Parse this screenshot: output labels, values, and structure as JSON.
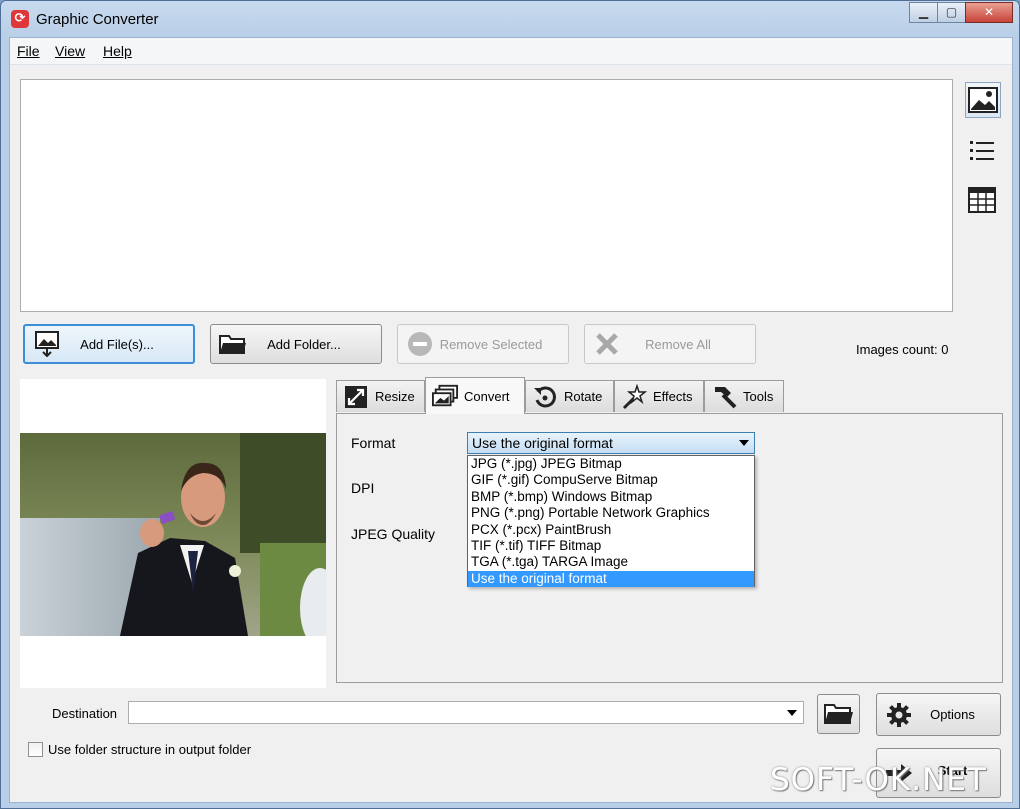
{
  "window": {
    "title": "Graphic Converter",
    "min_label": "▁",
    "max_label": "▢",
    "close_label": "✕"
  },
  "menu": {
    "items": [
      "File",
      "View",
      "Help"
    ]
  },
  "buttons": {
    "add_files": "Add File(s)...",
    "add_folder": "Add Folder...",
    "remove_selected": "Remove Selected",
    "remove_all": "Remove All"
  },
  "images_count": "Images count: 0",
  "tabs": [
    {
      "label": "Resize",
      "icon": "resize-icon"
    },
    {
      "label": "Convert",
      "icon": "convert-icon"
    },
    {
      "label": "Rotate",
      "icon": "rotate-icon"
    },
    {
      "label": "Effects",
      "icon": "effects-icon"
    },
    {
      "label": "Tools",
      "icon": "tools-icon"
    }
  ],
  "convert": {
    "format_label": "Format",
    "dpi_label": "DPI",
    "jpeg_quality_label": "JPEG Quality",
    "format_value": "Use the original format",
    "format_options": [
      "JPG (*.jpg) JPEG Bitmap",
      "GIF (*.gif) CompuServe Bitmap",
      "BMP (*.bmp) Windows Bitmap",
      "PNG (*.png) Portable Network Graphics",
      "PCX (*.pcx) PaintBrush",
      "TIF (*.tif) TIFF Bitmap",
      "TGA (*.tga) TARGA Image",
      "Use the original format"
    ]
  },
  "destination": {
    "label": "Destination",
    "value": ""
  },
  "options_label": "Options",
  "start_label": "Start",
  "checkbox": {
    "label": "Use folder structure in output folder",
    "checked": false
  },
  "watermark": "SOFT-OK.NET",
  "colors": {
    "accent": "#3399ff",
    "title_bg": "#b9cfe7"
  }
}
